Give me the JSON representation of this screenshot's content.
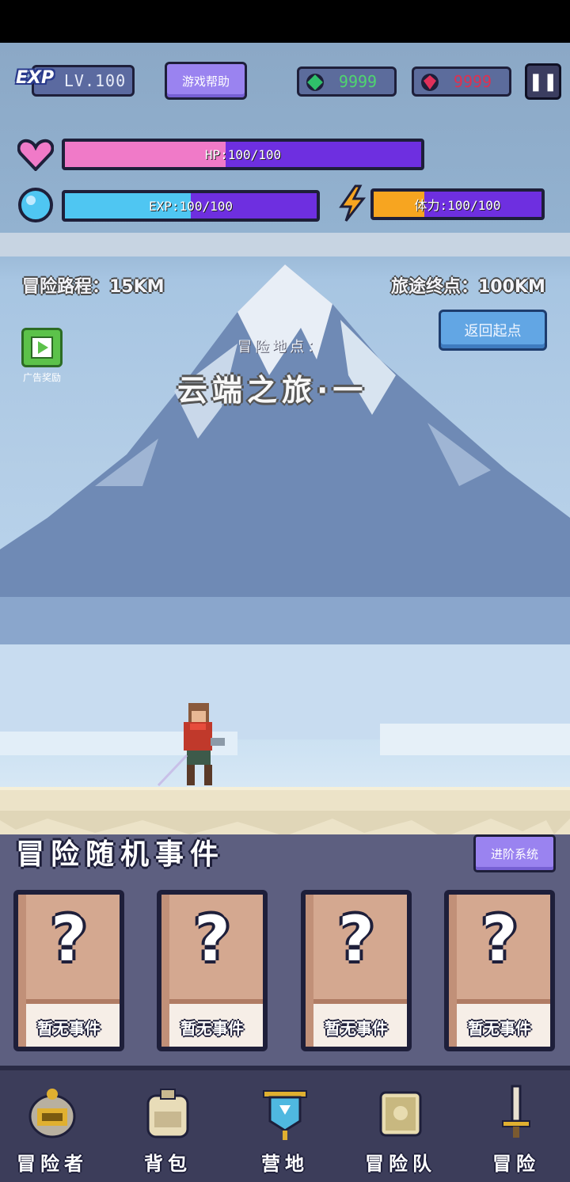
{
  "hud": {
    "exp_badge": "EXP",
    "level": "LV.100",
    "help_label": "游戏帮助",
    "green_currency": "9999",
    "red_currency": "9999",
    "pause_icon": "pause-icon"
  },
  "stats": {
    "hp_text": "HP:100/100",
    "hp_fraction": 0.45,
    "exp_text": "EXP:100/100",
    "exp_fraction": 0.5,
    "stamina_text": "体力:100/100",
    "stamina_fraction": 0.3
  },
  "adventure": {
    "route": "冒险路程：15KM",
    "destination": "旅途终点：100KM",
    "back_label": "返回起点",
    "ad_label": "广告奖励",
    "location_caption": "冒险地点：",
    "location_name": "云端之旅·一"
  },
  "events": {
    "title": "冒险随机事件",
    "advance_label": "进阶系统",
    "cards": [
      {
        "label": "暂无事件"
      },
      {
        "label": "暂无事件"
      },
      {
        "label": "暂无事件"
      },
      {
        "label": "暂无事件"
      }
    ]
  },
  "nav": {
    "items": [
      {
        "label": "冒险者",
        "icon": "helmet-icon"
      },
      {
        "label": "背包",
        "icon": "backpack-icon"
      },
      {
        "label": "营地",
        "icon": "banner-icon"
      },
      {
        "label": "冒险队",
        "icon": "book-icon"
      },
      {
        "label": "冒险",
        "icon": "sword-icon"
      }
    ]
  },
  "colors": {
    "hp": "#f07ac8",
    "exp": "#4fc6f2",
    "stamina": "#f7a520",
    "bar_empty": "#6e2fe0",
    "button_purple": "#9a83f0",
    "button_blue": "#62a6e4"
  }
}
